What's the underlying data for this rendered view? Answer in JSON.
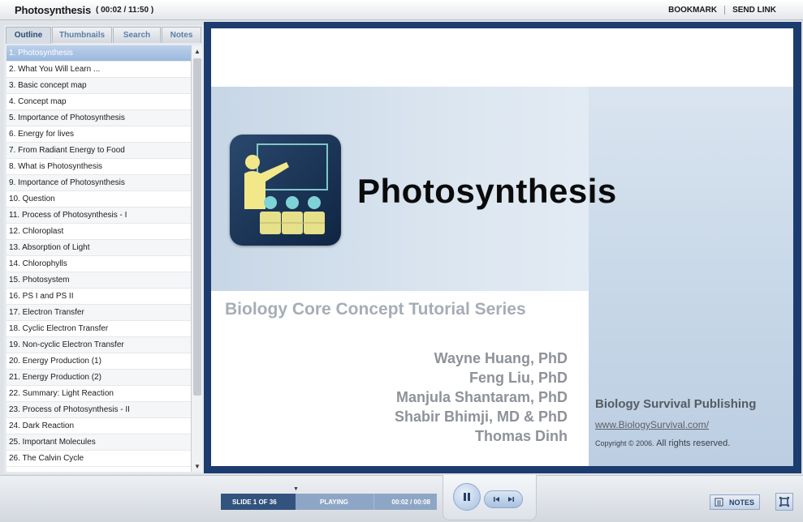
{
  "header": {
    "title": "Photosynthesis",
    "time": "( 00:02 / 11:50 )",
    "bookmark_label": "BOOKMARK",
    "send_link_label": "SEND LINK"
  },
  "sidebar": {
    "tabs": [
      "Outline",
      "Thumbnails",
      "Search",
      "Notes"
    ],
    "active_tab": "Outline",
    "items": [
      "1. Photosynthesis",
      "2. What You Will Learn ...",
      "3. Basic concept map",
      "4. Concept map",
      "5. Importance of Photosynthesis",
      "6. Energy for lives",
      "7. From Radiant Energy to Food",
      "8. What is Photosynthesis",
      "9. Importance of Photosynthesis",
      "10. Question",
      "11. Process of Photosynthesis - I",
      "12. Chloroplast",
      "13. Absorption of Light",
      "14. Chlorophylls",
      "15. Photosystem",
      "16. PS I and PS II",
      "17. Electron Transfer",
      "18. Cyclic Electron Transfer",
      "19. Non-cyclic Electron Transfer",
      "20. Energy Production (1)",
      "21. Energy Production (2)",
      "22. Summary: Light Reaction",
      "23. Process of Photosynthesis - II",
      "24. Dark Reaction",
      "25. Important Molecules",
      "26. The Calvin Cycle"
    ],
    "selected_index": 0
  },
  "slide": {
    "title": "Photosynthesis",
    "series": "Biology Core Concept Tutorial Series",
    "authors": [
      "Wayne Huang, PhD",
      "Feng Liu, PhD",
      "Manjula Shantaram, PhD",
      "Shabir Bhimji, MD & PhD",
      "Thomas Dinh"
    ],
    "publisher": "Biology Survival Publishing",
    "publisher_link": "www.BiologySurvival.com/",
    "copyright_prefix": "Copyright © 2006.",
    "copyright_rights": "All rights reserved."
  },
  "player": {
    "slide_count": "SLIDE 1 OF 36",
    "state": "PLAYING",
    "time": "00:02 / 00:08",
    "notes_label": "NOTES"
  },
  "colors": {
    "frame": "#1c3c6f",
    "accent": "#33537f",
    "selected_item": "#9ab8de"
  },
  "icons": [
    "presenter-logo-icon",
    "pause-icon",
    "prev-slide-icon",
    "next-slide-icon",
    "notes-icon",
    "fullscreen-icon",
    "scroll-up-icon",
    "scroll-down-icon"
  ]
}
